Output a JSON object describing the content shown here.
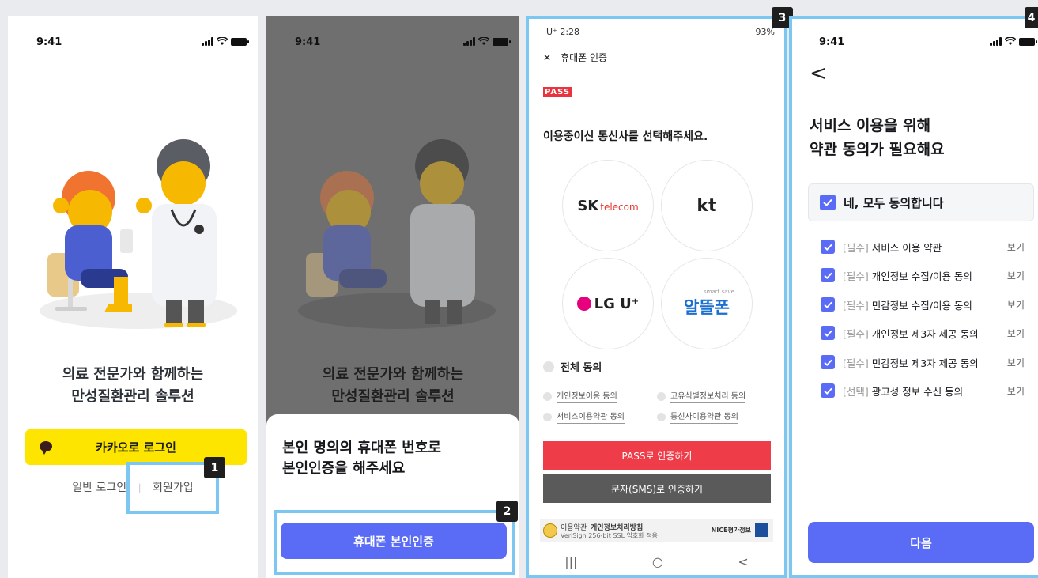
{
  "status": {
    "time": "9:41"
  },
  "screen1": {
    "headline_line1": "의료 전문가와 함께하는",
    "headline_line2": "만성질환관리 솔루션",
    "kakao_label": "카카오로 로그인",
    "login_link": "일반 로그인",
    "separator": "|",
    "signup_link": "회원가입",
    "badge": "1"
  },
  "screen2": {
    "headline_line1": "의료 전문가와 함께하는",
    "headline_line2": "만성질환관리 솔루션",
    "sheet_line1": "본인 명의의 휴대폰 번호로",
    "sheet_line2": "본인인증을 해주세요",
    "verify_button": "휴대폰 본인인증",
    "badge": "2"
  },
  "screen3": {
    "status_left": "U⁺ 2:28",
    "status_right": "93%",
    "close": "✕",
    "header_title": "휴대폰 인증",
    "pass_logo": "PASS",
    "question": "이용중이신 통신사를 선택해주세요.",
    "carriers": {
      "skt_sk": "SK",
      "skt_telecom": "telecom",
      "kt": "kt",
      "lgu": "LG U⁺",
      "mvno_small": "smart save",
      "mvno": "알뜰폰"
    },
    "agree_all": "전체 동의",
    "agree_items": [
      "개인정보이용 동의",
      "고유식별정보처리 동의",
      "서비스이용약관 동의",
      "통신사이용약관 동의"
    ],
    "pass_button": "PASS로 인증하기",
    "sms_button": "문자(SMS)로 인증하기",
    "footer_terms": "이용약관",
    "footer_privacy": "개인정보처리방침",
    "footer_ssl": "VeriSign 256-bit SSL 암호화 적용",
    "footer_nice": "NICE평가정보",
    "nav": [
      "|||",
      "○",
      "<"
    ],
    "badge": "3"
  },
  "screen4": {
    "back": "<",
    "title_line1": "서비스 이용을 위해",
    "title_line2": "약관 동의가 필요해요",
    "agree_all": "네, 모두 동의합니다",
    "terms": [
      {
        "tag": "[필수]",
        "label": "서비스 이용 약관",
        "view": "보기"
      },
      {
        "tag": "[필수]",
        "label": "개인정보 수집/이용 동의",
        "view": "보기"
      },
      {
        "tag": "[필수]",
        "label": "민감정보 수집/이용 동의",
        "view": "보기"
      },
      {
        "tag": "[필수]",
        "label": "개인정보 제3자 제공 동의",
        "view": "보기"
      },
      {
        "tag": "[필수]",
        "label": "민감정보 제3자 제공 동의",
        "view": "보기"
      },
      {
        "tag": "[선택]",
        "label": "광고성 정보 수신 동의",
        "view": "보기"
      }
    ],
    "next_button": "다음",
    "badge": "4"
  },
  "colors": {
    "accent": "#5a6cf5",
    "kakao": "#fee500",
    "pass_red": "#ee3d49",
    "highlight": "#7cc6f2"
  }
}
